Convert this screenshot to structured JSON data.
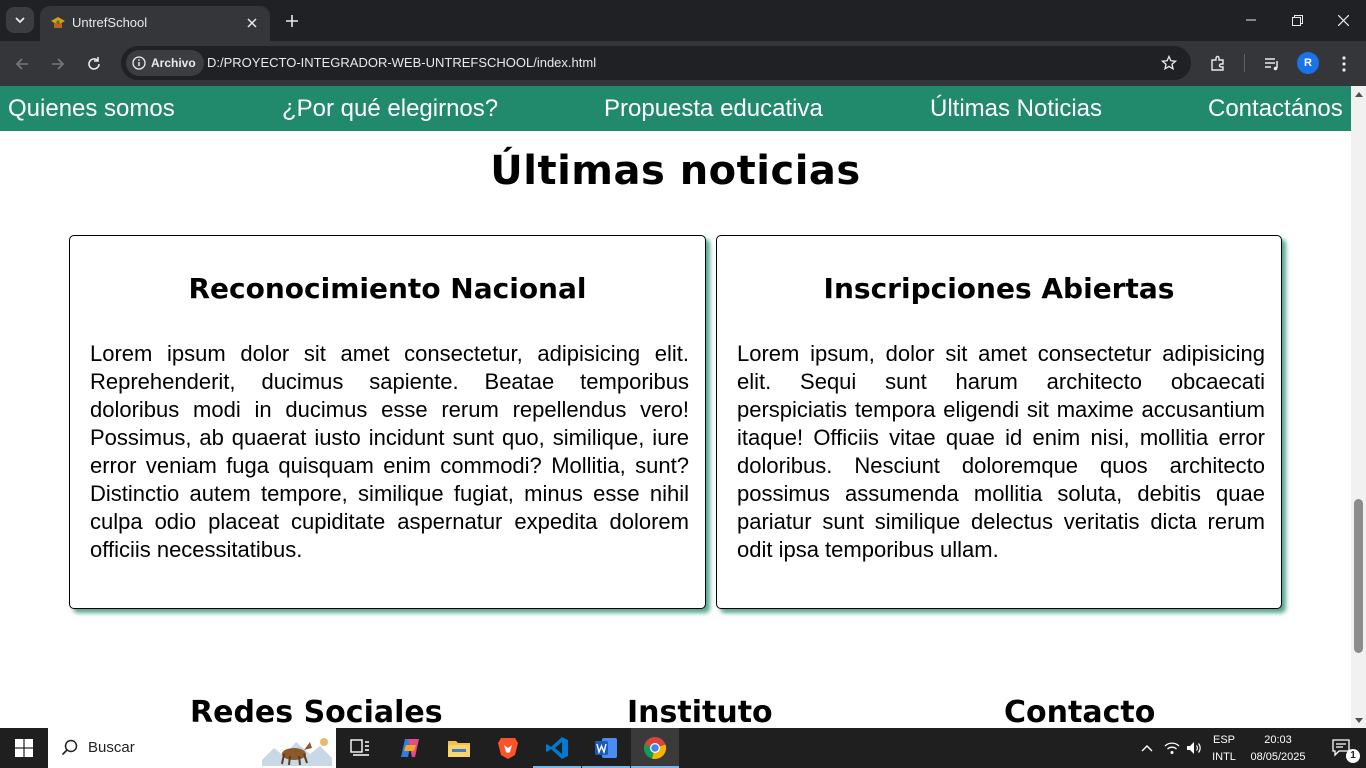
{
  "browser": {
    "tab_title": "UntrefSchool",
    "site_chip_label": "Archivo",
    "url": "D:/PROYECTO-INTEGRADOR-WEB-UNTREFSCHOOL/index.html",
    "profile_initial": "R"
  },
  "nav": {
    "items": [
      {
        "label": "Quienes somos"
      },
      {
        "label": "¿Por qué elegirnos?"
      },
      {
        "label": "Propuesta educativa"
      },
      {
        "label": "Últimas Noticias"
      },
      {
        "label": "Contactános"
      }
    ]
  },
  "news": {
    "title": "Últimas noticias",
    "cards": [
      {
        "title": "Reconocimiento Nacional",
        "body": "Lorem ipsum dolor sit amet consectetur, adipisicing elit. Reprehenderit, ducimus sapiente. Beatae temporibus doloribus modi in ducimus esse rerum repellendus vero! Possimus, ab quaerat iusto incidunt sunt quo, similique, iure error veniam fuga quisquam enim commodi? Mollitia, sunt? Distinctio autem tempore, similique fugiat, minus esse nihil culpa odio placeat cupiditate aspernatur expedita dolorem officiis necessitatibus."
      },
      {
        "title": "Inscripciones Abiertas",
        "body": "Lorem ipsum, dolor sit amet consectetur adipisicing elit. Sequi sunt harum architecto obcaecati perspiciatis tempora eligendi sit maxime accusantium itaque! Officiis vitae quae id enim nisi, mollitia error doloribus. Nesciunt doloremque quos architecto possimus assumenda mollitia soluta, debitis quae pariatur sunt similique delectus veritatis dicta rerum odit ipsa temporibus ullam."
      }
    ]
  },
  "footer": {
    "headings": [
      "Redes Sociales",
      "Instituto",
      "Contacto"
    ]
  },
  "taskbar": {
    "search_label": "Buscar",
    "lang_top": "ESP",
    "lang_bottom": "INTL",
    "time": "20:03",
    "date": "08/05/2025",
    "notification_count": "1"
  },
  "colors": {
    "nav_bg": "#218a6d",
    "card_shadow": "#218a6d"
  }
}
